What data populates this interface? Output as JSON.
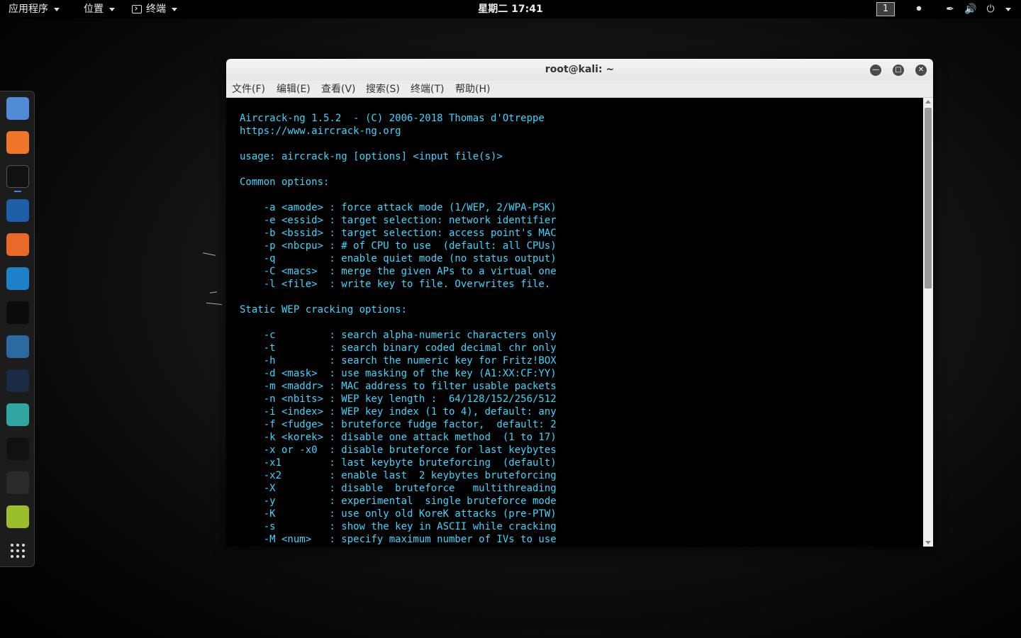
{
  "topbar": {
    "applications": "应用程序",
    "places": "位置",
    "terminal_app": "终端",
    "clock": "星期二 17:41",
    "workspace": "1"
  },
  "window": {
    "title": "root@kali: ~",
    "menus": [
      "文件(F)",
      "编辑(E)",
      "查看(V)",
      "搜索(S)",
      "终端(T)",
      "帮助(H)"
    ]
  },
  "terminal": {
    "lines": [
      "Aircrack-ng 1.5.2  - (C) 2006-2018 Thomas d'Otreppe",
      "https://www.aircrack-ng.org",
      "",
      "usage: aircrack-ng [options] <input file(s)>",
      "",
      "Common options:",
      "",
      "    -a <amode> : force attack mode (1/WEP, 2/WPA-PSK)",
      "    -e <essid> : target selection: network identifier",
      "    -b <bssid> : target selection: access point's MAC",
      "    -p <nbcpu> : # of CPU to use  (default: all CPUs)",
      "    -q         : enable quiet mode (no status output)",
      "    -C <macs>  : merge the given APs to a virtual one",
      "    -l <file>  : write key to file. Overwrites file.",
      "",
      "Static WEP cracking options:",
      "",
      "    -c         : search alpha-numeric characters only",
      "    -t         : search binary coded decimal chr only",
      "    -h         : search the numeric key for Fritz!BOX",
      "    -d <mask>  : use masking of the key (A1:XX:CF:YY)",
      "    -m <maddr> : MAC address to filter usable packets",
      "    -n <nbits> : WEP key length :  64/128/152/256/512",
      "    -i <index> : WEP key index (1 to 4), default: any",
      "    -f <fudge> : bruteforce fudge factor,  default: 2",
      "    -k <korek> : disable one attack method  (1 to 17)",
      "    -x or -x0  : disable bruteforce for last keybytes",
      "    -x1        : last keybyte bruteforcing  (default)",
      "    -x2        : enable last  2 keybytes bruteforcing",
      "    -X         : disable  bruteforce   multithreading",
      "    -y         : experimental  single bruteforce mode",
      "    -K         : use only old KoreK attacks (pre-PTW)",
      "    -s         : show the key in ASCII while cracking",
      "    -M <num>   : specify maximum number of IVs to use"
    ],
    "text_color": "#3bd7ff",
    "background": "#000000"
  },
  "dock": {
    "apps": [
      {
        "icon": "files-icon",
        "color": "#4f8bd6"
      },
      {
        "icon": "firefox-icon",
        "color": "#f0762a"
      },
      {
        "icon": "terminal-icon",
        "color": "#111111",
        "running": true
      },
      {
        "icon": "maltego-icon",
        "color": "#1d5fa8"
      },
      {
        "icon": "burpsuite-icon",
        "color": "#e8692a"
      },
      {
        "icon": "wireshark-icon",
        "color": "#1f7fc9"
      },
      {
        "icon": "set-icon",
        "color": "#0b0b0b"
      },
      {
        "icon": "armitage-icon",
        "color": "#2b6aa0"
      },
      {
        "icon": "beef-icon",
        "color": "#1b2a44"
      },
      {
        "icon": "faraday-icon",
        "color": "#2fa6a0"
      },
      {
        "icon": "edb-icon",
        "color": "#111111"
      },
      {
        "icon": "magnifier-icon",
        "color": "#2a2a2a"
      },
      {
        "icon": "android-icon",
        "color": "#9bbf2a"
      },
      {
        "icon": "app-grid-icon",
        "color": "transparent"
      }
    ]
  }
}
